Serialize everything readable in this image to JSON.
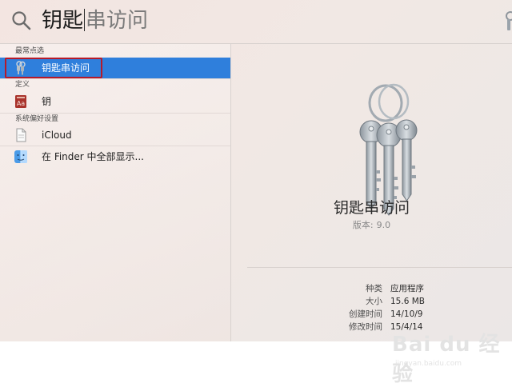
{
  "search": {
    "typed": "钥匙",
    "suggestion": "串访问"
  },
  "sections": [
    {
      "title": "最常点选"
    },
    {
      "title": "定义"
    },
    {
      "title": "系统偏好设置"
    }
  ],
  "results": [
    {
      "label": "钥匙串访问",
      "icon": "keychain-icon",
      "selected": true
    },
    {
      "label": "钥",
      "icon": "dictionary-icon"
    },
    {
      "label": "iCloud",
      "icon": "document-icon"
    },
    {
      "label": "在 Finder 中全部显示...",
      "icon": "finder-icon"
    }
  ],
  "preview": {
    "app_name": "钥匙串访问",
    "version_label": "版本:",
    "version": "9.0",
    "meta": [
      {
        "key": "种类",
        "value": "应用程序"
      },
      {
        "key": "大小",
        "value": "15.6 MB"
      },
      {
        "key": "创建时间",
        "value": "14/10/9"
      },
      {
        "key": "修改时间",
        "value": "15/4/14"
      }
    ]
  },
  "colors": {
    "selection": "#2f7fdc",
    "highlight_border": "#b51a2a"
  },
  "watermark": {
    "brand": "Bai du 经验",
    "url": "jingyan.baidu.com"
  }
}
